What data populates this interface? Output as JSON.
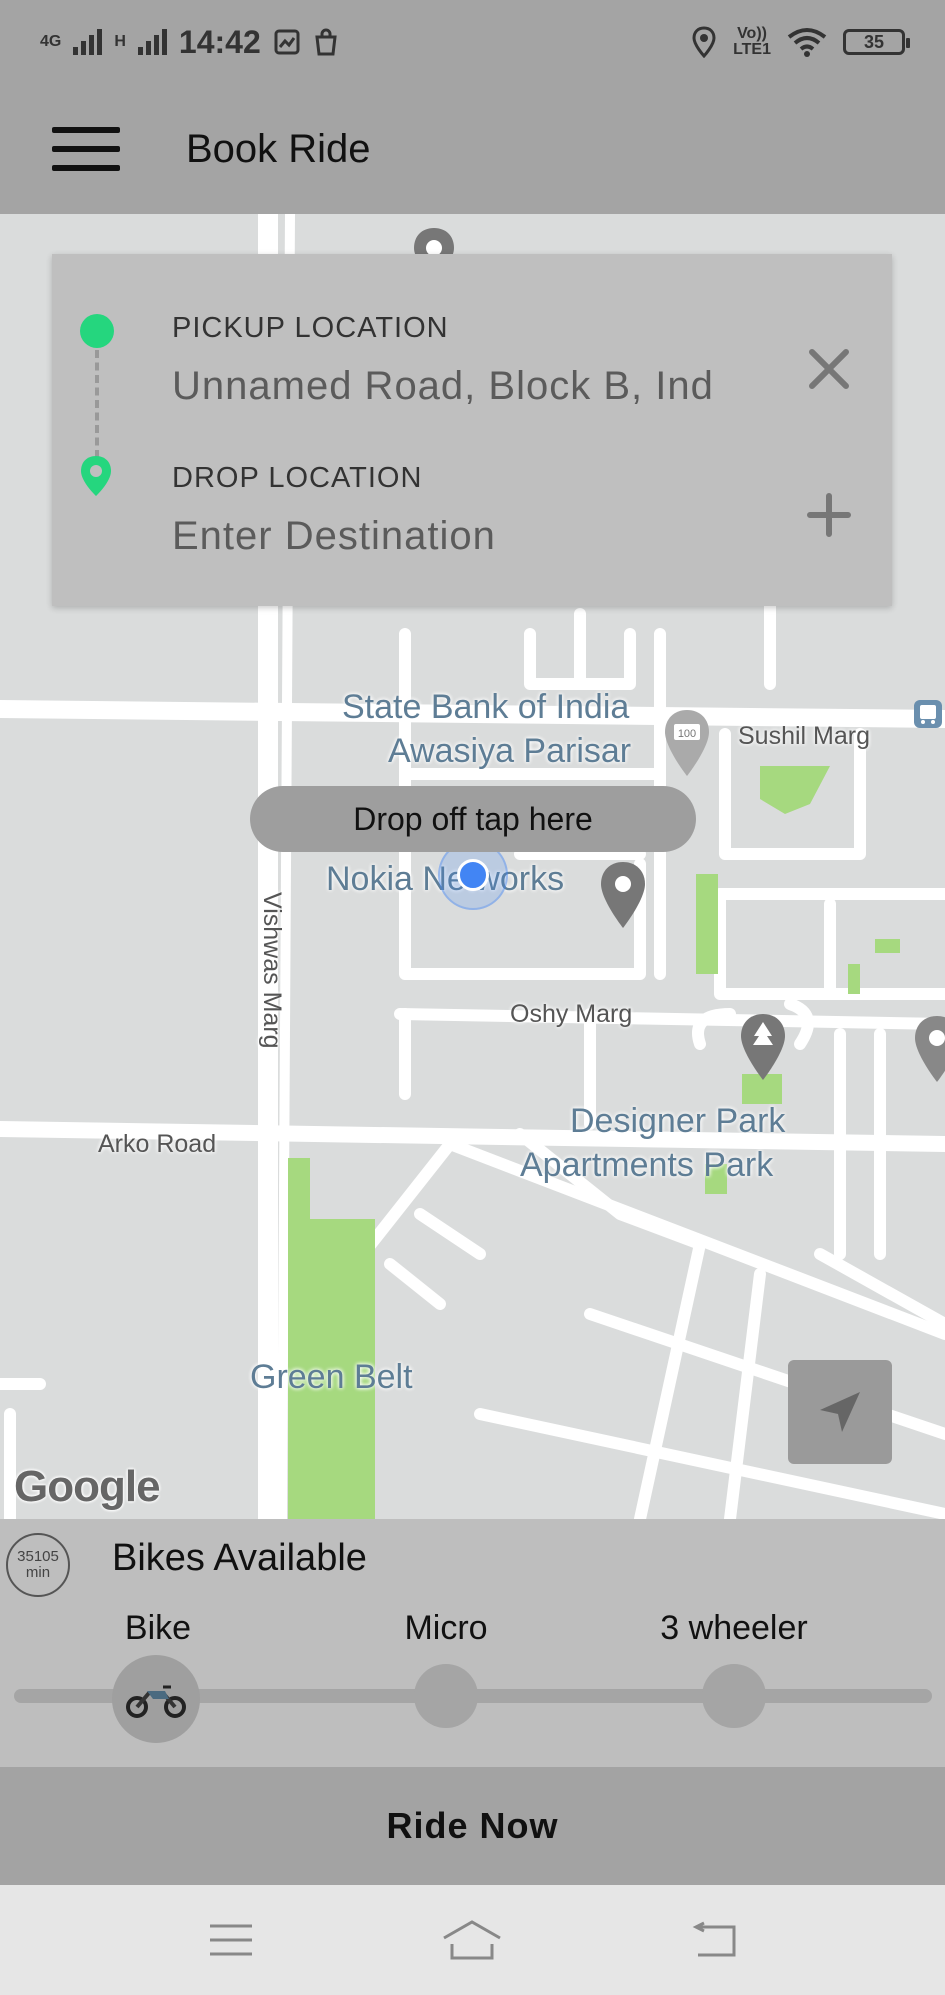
{
  "status_bar": {
    "network_top": "4G",
    "network_bottom": "H",
    "time": "14:42",
    "lte_top": "Vo))",
    "lte_bottom": "LTE1",
    "battery": "35"
  },
  "app_bar": {
    "title": "Book Ride"
  },
  "location_card": {
    "pickup_label": "PICKUP LOCATION",
    "pickup_value": "Unnamed Road, Block B, Ind",
    "drop_label": "DROP LOCATION",
    "drop_placeholder": "Enter Destination"
  },
  "map": {
    "labels": {
      "sbi_line1": "State Bank of India",
      "sbi_line2": "Awasiya Parisar",
      "sushil_marg": "Sushil Marg",
      "nokia": "Nokia Networks",
      "vishwas_marg": "Vishwas Marg",
      "oshy_marg": "Oshy Marg",
      "designer_line1": "Designer Park",
      "designer_line2": "Apartments Park",
      "arko_road": "Arko Road",
      "green_belt": "Green Belt",
      "google": "Google",
      "pin_badge": "100"
    },
    "tooltip": "Drop off tap here"
  },
  "bottom_sheet": {
    "eta_value": "35105",
    "eta_unit": "min",
    "title": "Bikes Available",
    "vehicles": [
      {
        "label": "Bike",
        "selected": true
      },
      {
        "label": "Micro",
        "selected": false
      },
      {
        "label": "3 wheeler",
        "selected": false
      }
    ]
  },
  "ride_now": {
    "label": "Ride Now"
  },
  "icons": {
    "menu": "hamburger-icon",
    "clear": "close-icon",
    "add": "plus-icon",
    "locate": "navigation-arrow-icon",
    "bike": "motorcycle-icon"
  },
  "colors": {
    "pickup_dot": "#25d67e",
    "user_location": "#4285f4",
    "map_background": "#dadcdc",
    "park_green": "#a6d97f"
  }
}
